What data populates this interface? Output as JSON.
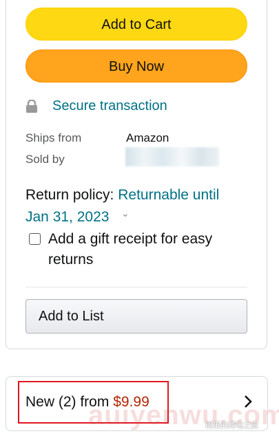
{
  "buttons": {
    "add_to_cart": "Add to Cart",
    "buy_now": "Buy Now",
    "add_to_list": "Add to List"
  },
  "secure": {
    "label": "Secure transaction",
    "icon": "lock-icon"
  },
  "shipping": {
    "ships_from_label": "Ships from",
    "ships_from_value": "Amazon",
    "sold_by_label": "Sold by"
  },
  "return_policy": {
    "label": "Return policy:",
    "link_text": "Returnable until Jan 31, 2023",
    "chevron_icon": "chevron-down-icon"
  },
  "gift_receipt": {
    "label": "Add a gift receipt for easy returns",
    "checked": false
  },
  "offers": {
    "prefix": "New (2) from",
    "price": "$9.99",
    "chevron_icon": "chevron-right-icon"
  },
  "watermark": {
    "main": "auiyenwu.com",
    "small": "雨果的跨境之旅"
  },
  "colors": {
    "yellow": "#ffd814",
    "orange": "#ffa41c",
    "link": "#007185",
    "price": "#b12704",
    "highlight": "#e0161e"
  }
}
